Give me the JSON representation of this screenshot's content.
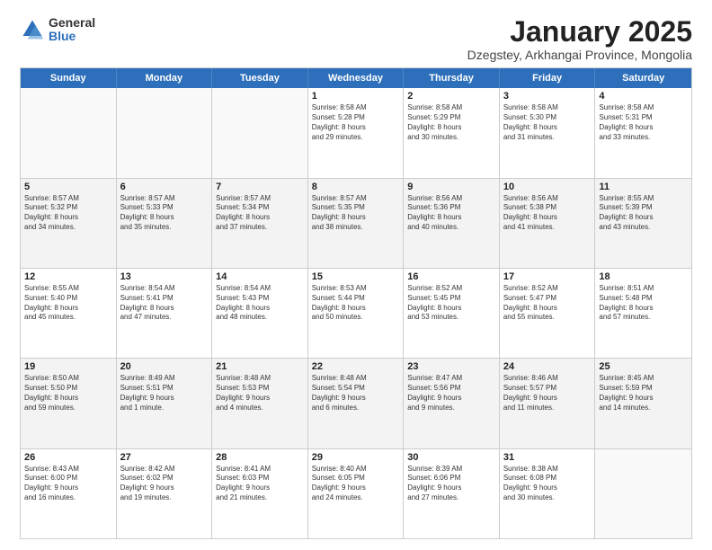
{
  "logo": {
    "general": "General",
    "blue": "Blue"
  },
  "title": "January 2025",
  "subtitle": "Dzegstey, Arkhangai Province, Mongolia",
  "days": [
    "Sunday",
    "Monday",
    "Tuesday",
    "Wednesday",
    "Thursday",
    "Friday",
    "Saturday"
  ],
  "weeks": [
    [
      {
        "day": "",
        "lines": [],
        "empty": true
      },
      {
        "day": "",
        "lines": [],
        "empty": true
      },
      {
        "day": "",
        "lines": [],
        "empty": true
      },
      {
        "day": "1",
        "lines": [
          "Sunrise: 8:58 AM",
          "Sunset: 5:28 PM",
          "Daylight: 8 hours",
          "and 29 minutes."
        ]
      },
      {
        "day": "2",
        "lines": [
          "Sunrise: 8:58 AM",
          "Sunset: 5:29 PM",
          "Daylight: 8 hours",
          "and 30 minutes."
        ]
      },
      {
        "day": "3",
        "lines": [
          "Sunrise: 8:58 AM",
          "Sunset: 5:30 PM",
          "Daylight: 8 hours",
          "and 31 minutes."
        ]
      },
      {
        "day": "4",
        "lines": [
          "Sunrise: 8:58 AM",
          "Sunset: 5:31 PM",
          "Daylight: 8 hours",
          "and 33 minutes."
        ]
      }
    ],
    [
      {
        "day": "5",
        "lines": [
          "Sunrise: 8:57 AM",
          "Sunset: 5:32 PM",
          "Daylight: 8 hours",
          "and 34 minutes."
        ],
        "shaded": true
      },
      {
        "day": "6",
        "lines": [
          "Sunrise: 8:57 AM",
          "Sunset: 5:33 PM",
          "Daylight: 8 hours",
          "and 35 minutes."
        ],
        "shaded": true
      },
      {
        "day": "7",
        "lines": [
          "Sunrise: 8:57 AM",
          "Sunset: 5:34 PM",
          "Daylight: 8 hours",
          "and 37 minutes."
        ],
        "shaded": true
      },
      {
        "day": "8",
        "lines": [
          "Sunrise: 8:57 AM",
          "Sunset: 5:35 PM",
          "Daylight: 8 hours",
          "and 38 minutes."
        ],
        "shaded": true
      },
      {
        "day": "9",
        "lines": [
          "Sunrise: 8:56 AM",
          "Sunset: 5:36 PM",
          "Daylight: 8 hours",
          "and 40 minutes."
        ],
        "shaded": true
      },
      {
        "day": "10",
        "lines": [
          "Sunrise: 8:56 AM",
          "Sunset: 5:38 PM",
          "Daylight: 8 hours",
          "and 41 minutes."
        ],
        "shaded": true
      },
      {
        "day": "11",
        "lines": [
          "Sunrise: 8:55 AM",
          "Sunset: 5:39 PM",
          "Daylight: 8 hours",
          "and 43 minutes."
        ],
        "shaded": true
      }
    ],
    [
      {
        "day": "12",
        "lines": [
          "Sunrise: 8:55 AM",
          "Sunset: 5:40 PM",
          "Daylight: 8 hours",
          "and 45 minutes."
        ]
      },
      {
        "day": "13",
        "lines": [
          "Sunrise: 8:54 AM",
          "Sunset: 5:41 PM",
          "Daylight: 8 hours",
          "and 47 minutes."
        ]
      },
      {
        "day": "14",
        "lines": [
          "Sunrise: 8:54 AM",
          "Sunset: 5:43 PM",
          "Daylight: 8 hours",
          "and 48 minutes."
        ]
      },
      {
        "day": "15",
        "lines": [
          "Sunrise: 8:53 AM",
          "Sunset: 5:44 PM",
          "Daylight: 8 hours",
          "and 50 minutes."
        ]
      },
      {
        "day": "16",
        "lines": [
          "Sunrise: 8:52 AM",
          "Sunset: 5:45 PM",
          "Daylight: 8 hours",
          "and 53 minutes."
        ]
      },
      {
        "day": "17",
        "lines": [
          "Sunrise: 8:52 AM",
          "Sunset: 5:47 PM",
          "Daylight: 8 hours",
          "and 55 minutes."
        ]
      },
      {
        "day": "18",
        "lines": [
          "Sunrise: 8:51 AM",
          "Sunset: 5:48 PM",
          "Daylight: 8 hours",
          "and 57 minutes."
        ]
      }
    ],
    [
      {
        "day": "19",
        "lines": [
          "Sunrise: 8:50 AM",
          "Sunset: 5:50 PM",
          "Daylight: 8 hours",
          "and 59 minutes."
        ],
        "shaded": true
      },
      {
        "day": "20",
        "lines": [
          "Sunrise: 8:49 AM",
          "Sunset: 5:51 PM",
          "Daylight: 9 hours",
          "and 1 minute."
        ],
        "shaded": true
      },
      {
        "day": "21",
        "lines": [
          "Sunrise: 8:48 AM",
          "Sunset: 5:53 PM",
          "Daylight: 9 hours",
          "and 4 minutes."
        ],
        "shaded": true
      },
      {
        "day": "22",
        "lines": [
          "Sunrise: 8:48 AM",
          "Sunset: 5:54 PM",
          "Daylight: 9 hours",
          "and 6 minutes."
        ],
        "shaded": true
      },
      {
        "day": "23",
        "lines": [
          "Sunrise: 8:47 AM",
          "Sunset: 5:56 PM",
          "Daylight: 9 hours",
          "and 9 minutes."
        ],
        "shaded": true
      },
      {
        "day": "24",
        "lines": [
          "Sunrise: 8:46 AM",
          "Sunset: 5:57 PM",
          "Daylight: 9 hours",
          "and 11 minutes."
        ],
        "shaded": true
      },
      {
        "day": "25",
        "lines": [
          "Sunrise: 8:45 AM",
          "Sunset: 5:59 PM",
          "Daylight: 9 hours",
          "and 14 minutes."
        ],
        "shaded": true
      }
    ],
    [
      {
        "day": "26",
        "lines": [
          "Sunrise: 8:43 AM",
          "Sunset: 6:00 PM",
          "Daylight: 9 hours",
          "and 16 minutes."
        ]
      },
      {
        "day": "27",
        "lines": [
          "Sunrise: 8:42 AM",
          "Sunset: 6:02 PM",
          "Daylight: 9 hours",
          "and 19 minutes."
        ]
      },
      {
        "day": "28",
        "lines": [
          "Sunrise: 8:41 AM",
          "Sunset: 6:03 PM",
          "Daylight: 9 hours",
          "and 21 minutes."
        ]
      },
      {
        "day": "29",
        "lines": [
          "Sunrise: 8:40 AM",
          "Sunset: 6:05 PM",
          "Daylight: 9 hours",
          "and 24 minutes."
        ]
      },
      {
        "day": "30",
        "lines": [
          "Sunrise: 8:39 AM",
          "Sunset: 6:06 PM",
          "Daylight: 9 hours",
          "and 27 minutes."
        ]
      },
      {
        "day": "31",
        "lines": [
          "Sunrise: 8:38 AM",
          "Sunset: 6:08 PM",
          "Daylight: 9 hours",
          "and 30 minutes."
        ]
      },
      {
        "day": "",
        "lines": [],
        "empty": true
      }
    ]
  ]
}
